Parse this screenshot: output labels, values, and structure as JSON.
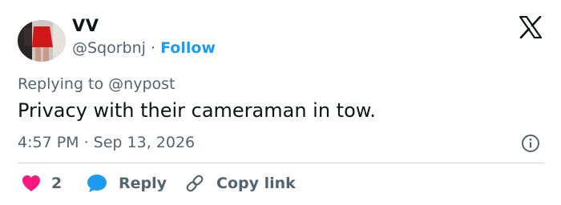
{
  "author": {
    "display_name": "VV",
    "handle": "@Sqorbnj",
    "separator": " · ",
    "follow_label": "Follow"
  },
  "platform_icon": "x-logo-icon",
  "reply_context": {
    "prefix": "Replying to ",
    "mention": "@nypost"
  },
  "tweet": {
    "text": "Privacy with their cameraman in tow.",
    "timestamp": "4:57 PM · Sep 13, 2026"
  },
  "actions": {
    "like_count": "2",
    "reply_label": "Reply",
    "copy_link_label": "Copy link"
  },
  "colors": {
    "accent": "#1d9bf0",
    "like": "#f91880",
    "text": "#0f1419",
    "muted": "#536471",
    "divider": "#cfd9de"
  }
}
